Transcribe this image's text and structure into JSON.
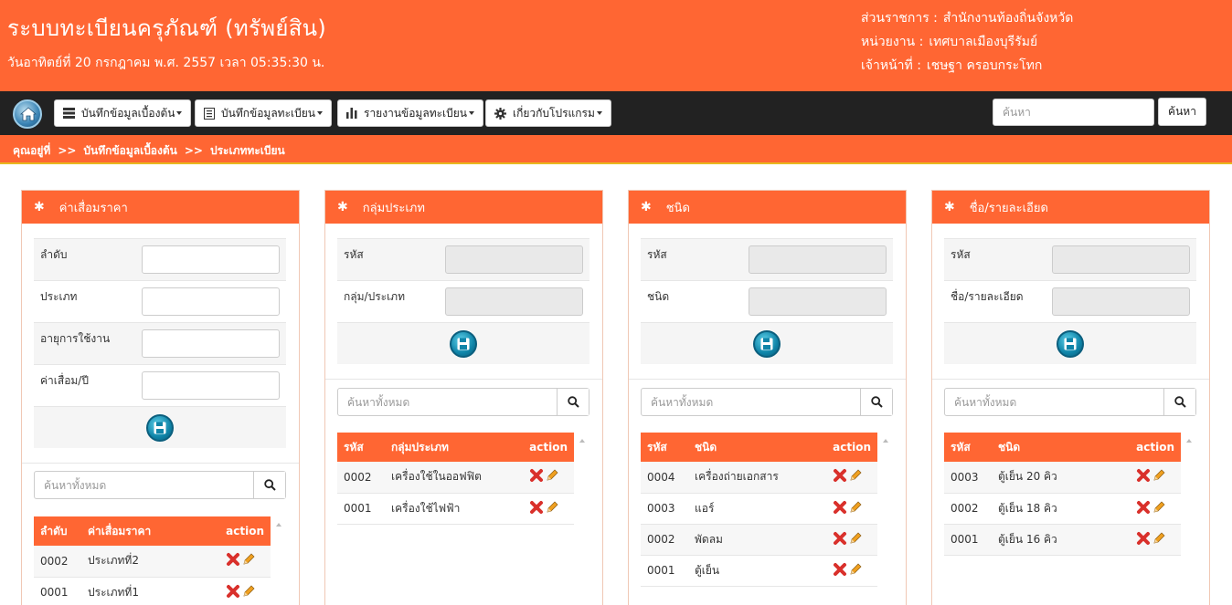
{
  "header": {
    "title": "ระบบทะเบียนครุภัณฑ์ (ทรัพย์สิน)",
    "date_line": "วันอาทิตย์ที่ 20 กรกฎาคม พ.ศ. 2557 เวลา 05:35:30 น.",
    "agency_label": "ส่วนราชการ :",
    "agency_value": "สำนักงานท้องถิ่นจังหวัด",
    "unit_label": "หน่วยงาน :",
    "unit_value": "เทศบาลเมืองบุรีรัมย์",
    "officer_label": "เจ้าหน้าที่ :",
    "officer_value": "เชษฐา ครอบกระโทก"
  },
  "nav": {
    "menus": [
      "บันทึกข้อมูลเบื้องต้น",
      "บันทึกข้อมูลทะเบียน",
      "รายงานข้อมูลทะเบียน",
      "เกี่ยวกับโปรแกรม"
    ],
    "search_placeholder": "ค้นหา",
    "search_button": "ค้นหา"
  },
  "breadcrumb": {
    "here": "คุณอยู่ที่",
    "sep": ">>",
    "level1": "บันทึกข้อมูลเบื้องต้น",
    "level2": "ประเภททะเบียน"
  },
  "search_all_placeholder": "ค้นหาทั้งหมด",
  "panels": [
    {
      "title": "ค่าเสื่อมราคา",
      "fields": [
        "ลำดับ",
        "ประเภท",
        "อายุการใช้งาน",
        "ค่าเสื่อม/ปี"
      ],
      "columns": [
        "ลำดับ",
        "ค่าเสื่อมราคา",
        "action"
      ],
      "rows": [
        [
          "0002",
          "ประเภทที่2"
        ],
        [
          "0001",
          "ประเภทที่1"
        ]
      ]
    },
    {
      "title": "กลุ่มประเภท",
      "fields": [
        "รหัส",
        "กลุ่ม/ประเภท"
      ],
      "columns": [
        "รหัส",
        "กลุ่มประเภท",
        "action"
      ],
      "rows": [
        [
          "0002",
          "เครื่องใช้ในออฟฟิต"
        ],
        [
          "0001",
          "เครื่องใช้ไฟฟ้า"
        ]
      ]
    },
    {
      "title": "ชนิด",
      "fields": [
        "รหัส",
        "ชนิด"
      ],
      "columns": [
        "รหัส",
        "ชนิด",
        "action"
      ],
      "rows": [
        [
          "0004",
          "เครื่องถ่ายเอกสาร"
        ],
        [
          "0003",
          "แอร์"
        ],
        [
          "0002",
          "พัดลม"
        ],
        [
          "0001",
          "ตู้เย็น"
        ]
      ]
    },
    {
      "title": "ชื่อ/รายละเอียด",
      "fields": [
        "รหัส",
        "ชื่อ/รายละเอียด"
      ],
      "columns": [
        "รหัส",
        "ชนิด",
        "action"
      ],
      "rows": [
        [
          "0003",
          "ตู้เย็น 20 คิว"
        ],
        [
          "0002",
          "ตู้เย็น 18 คิว"
        ],
        [
          "0001",
          "ตู้เย็น 16 คิว"
        ]
      ]
    }
  ],
  "colors": {
    "accent": "#ff6633",
    "navbar": "#222222",
    "delete": "#d9302b",
    "edit": "#f0a020"
  }
}
